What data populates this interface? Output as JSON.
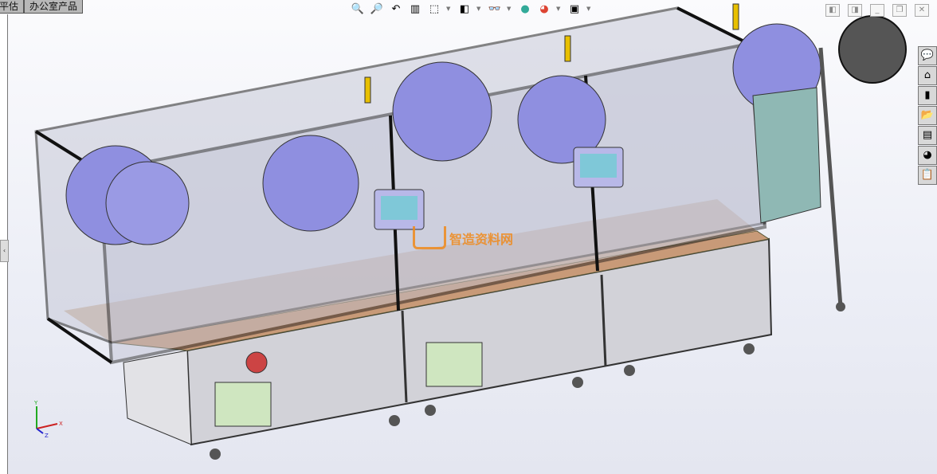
{
  "tabs": [
    {
      "label": "平估"
    },
    {
      "label": "办公室产品"
    }
  ],
  "heads_up_toolbar": [
    {
      "icon": "zoom-to-fit-icon",
      "glyph": "🔍"
    },
    {
      "icon": "zoom-to-area-icon",
      "glyph": "🔎"
    },
    {
      "icon": "previous-view-icon",
      "glyph": "↶"
    },
    {
      "icon": "section-view-icon",
      "glyph": "▥"
    },
    {
      "icon": "view-orientation-icon",
      "glyph": "⬚"
    },
    {
      "icon": "display-style-icon",
      "glyph": "◧"
    },
    {
      "icon": "hide-show-items-icon",
      "glyph": "👓"
    },
    {
      "icon": "edit-appearance-icon",
      "glyph": "●"
    },
    {
      "icon": "apply-scene-icon",
      "glyph": "◕"
    },
    {
      "icon": "view-settings-icon",
      "glyph": "▣"
    }
  ],
  "window_controls": [
    "tile-left-icon",
    "tile-right-icon",
    "minimize-icon",
    "restore-icon",
    "close-icon"
  ],
  "task_pane": [
    {
      "icon": "solidworks-resources-icon",
      "glyph": "💬"
    },
    {
      "icon": "home-icon",
      "glyph": "⌂"
    },
    {
      "icon": "design-library-icon",
      "glyph": "▮"
    },
    {
      "icon": "file-explorer-icon",
      "glyph": "📂"
    },
    {
      "icon": "view-palette-icon",
      "glyph": "▤"
    },
    {
      "icon": "appearances-icon",
      "glyph": "◕"
    },
    {
      "icon": "custom-properties-icon",
      "glyph": "📋"
    }
  ],
  "watermark": "智造资料网",
  "triad": {
    "x": "X",
    "y": "Y",
    "z": "Z"
  },
  "colors": {
    "disc": "#8f8fe0",
    "frame": "#222222",
    "glass": "#c8cad8",
    "table": "#c89a78",
    "cabinet": "#cfcfd4",
    "reel": "#555555",
    "tower": "#e8c000"
  }
}
